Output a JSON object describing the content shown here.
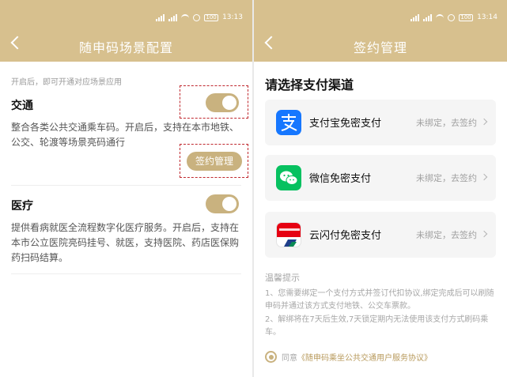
{
  "left": {
    "status": {
      "time": "13:13",
      "battery": "100"
    },
    "header": {
      "title": "随申码场景配置"
    },
    "hint": "开启后，即可开通对应场景应用",
    "traffic": {
      "title": "交通",
      "description": "整合各类公共交通乘车码。开启后，支持在本市地铁、公交、轮渡等场景亮码通行",
      "button_label": "签约管理",
      "enabled": true
    },
    "medical": {
      "title": "医疗",
      "description": "提供看病就医全流程数字化医疗服务。开启后，支持在本市公立医院亮码挂号、就医，支持医院、药店医保购药扫码结算。",
      "enabled": true
    }
  },
  "right": {
    "status": {
      "time": "13:14",
      "battery": "100"
    },
    "header": {
      "title": "签约管理"
    },
    "heading": "请选择支付渠道",
    "channels": [
      {
        "name": "支付宝免密支付",
        "status": "未绑定，去签约",
        "icon": "alipay-icon",
        "color": "#1677ff"
      },
      {
        "name": "微信免密支付",
        "status": "未绑定，去签约",
        "icon": "wechat-icon",
        "color": "#07c160"
      },
      {
        "name": "云闪付免密支付",
        "status": "未绑定，去签约",
        "icon": "unionpay-icon",
        "color": "#e60012"
      }
    ],
    "tips_title": "温馨提示",
    "tips": [
      "1、您需要绑定一个支付方式并签订代扣协议,绑定完成后可以刷随申码并通过该方式支付地铁、公交车票款。",
      "2、解绑将在7天后生效,7天锁定期内无法使用该支付方式刷码乘车。"
    ],
    "agreement": {
      "prefix": "同意",
      "link": "《随申码乘坐公共交通用户服务协议》",
      "checked": true
    }
  },
  "theme": {
    "accent": "#c9b27f",
    "header_bg": "#d7c08e",
    "annotation": "#c0292f"
  }
}
